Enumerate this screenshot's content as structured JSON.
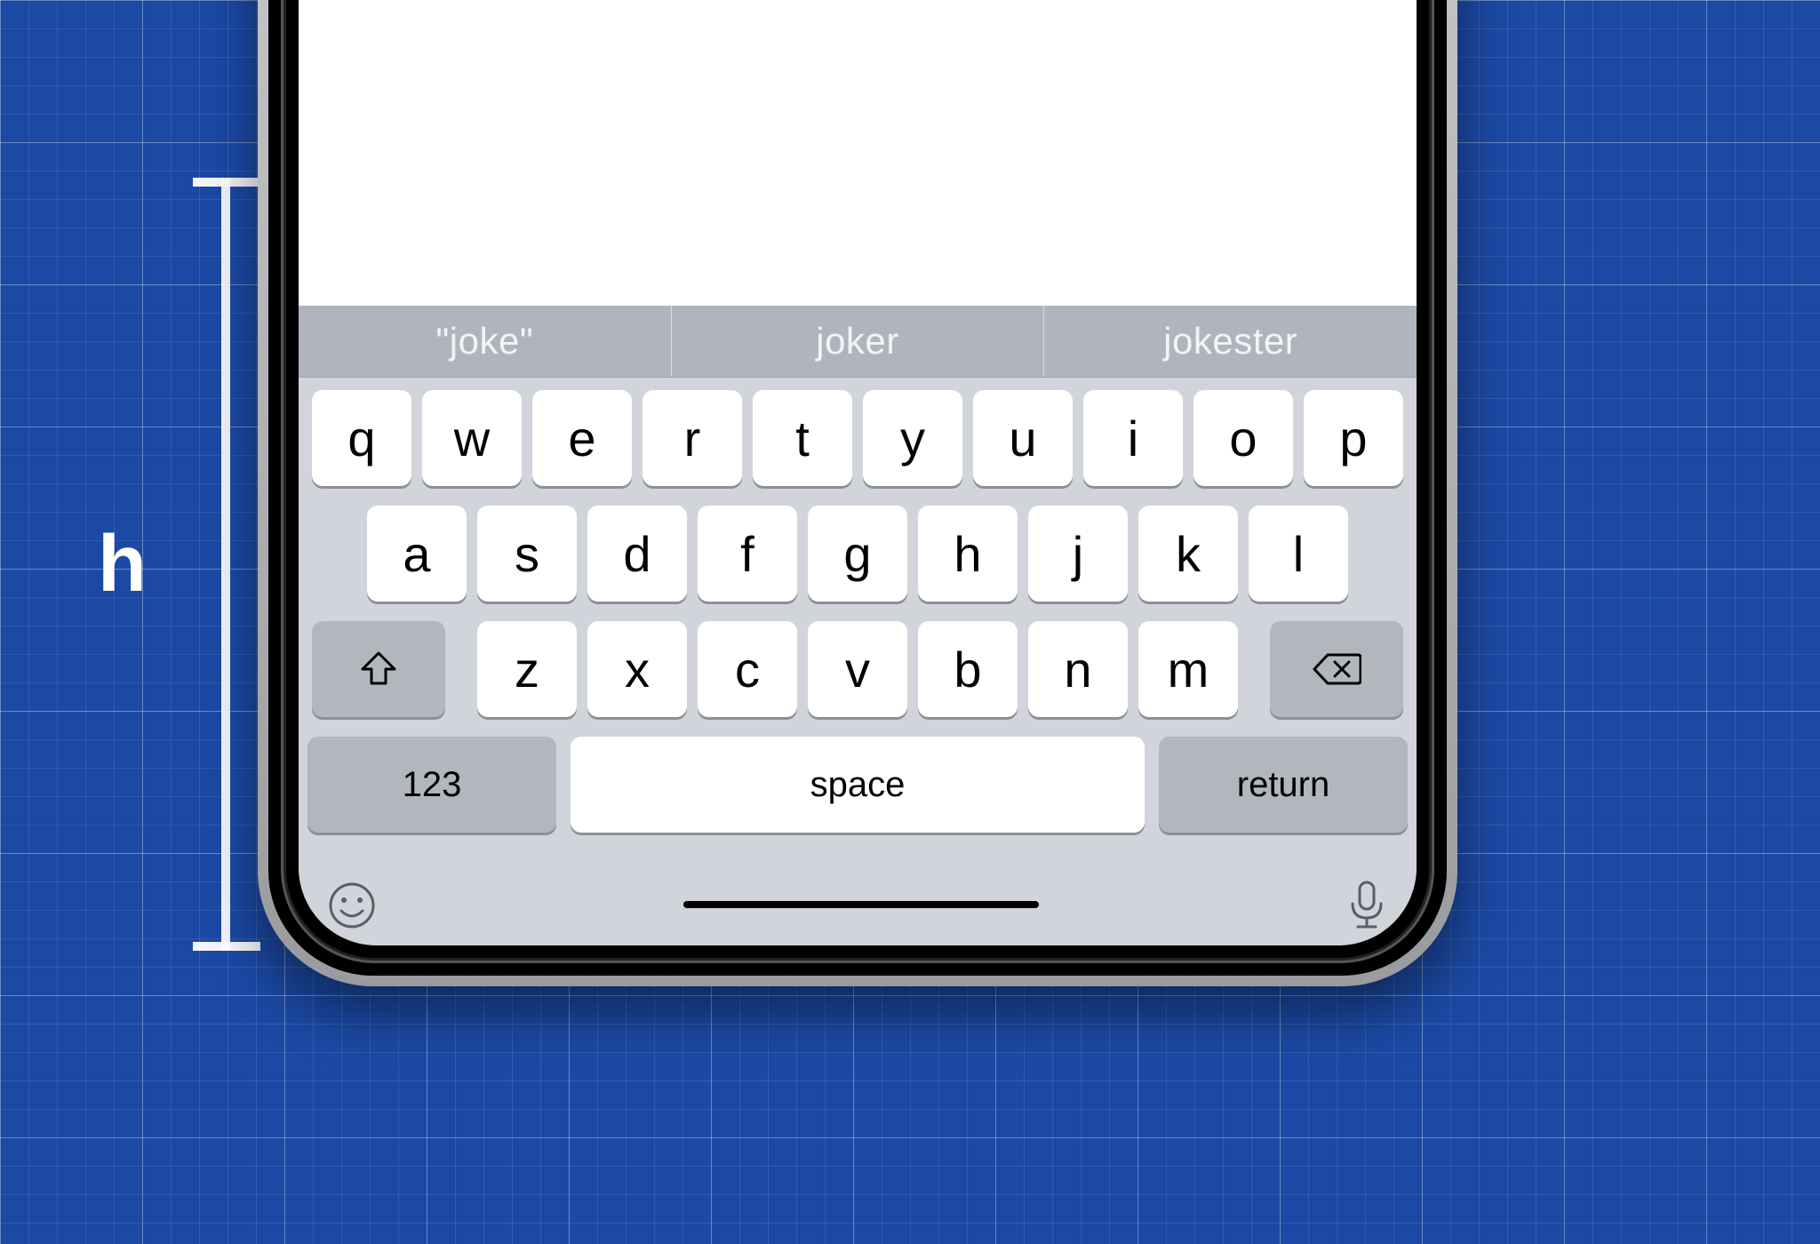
{
  "annotation": {
    "label": "h"
  },
  "keyboard": {
    "predictions": [
      "\"joke\"",
      "joker",
      "jokester"
    ],
    "rows": {
      "top": [
        "q",
        "w",
        "e",
        "r",
        "t",
        "y",
        "u",
        "i",
        "o",
        "p"
      ],
      "middle": [
        "a",
        "s",
        "d",
        "f",
        "g",
        "h",
        "j",
        "k",
        "l"
      ],
      "bottom": [
        "z",
        "x",
        "c",
        "v",
        "b",
        "n",
        "m"
      ]
    },
    "fn": {
      "numbers_label": "123",
      "space_label": "space",
      "return_label": "return"
    }
  }
}
